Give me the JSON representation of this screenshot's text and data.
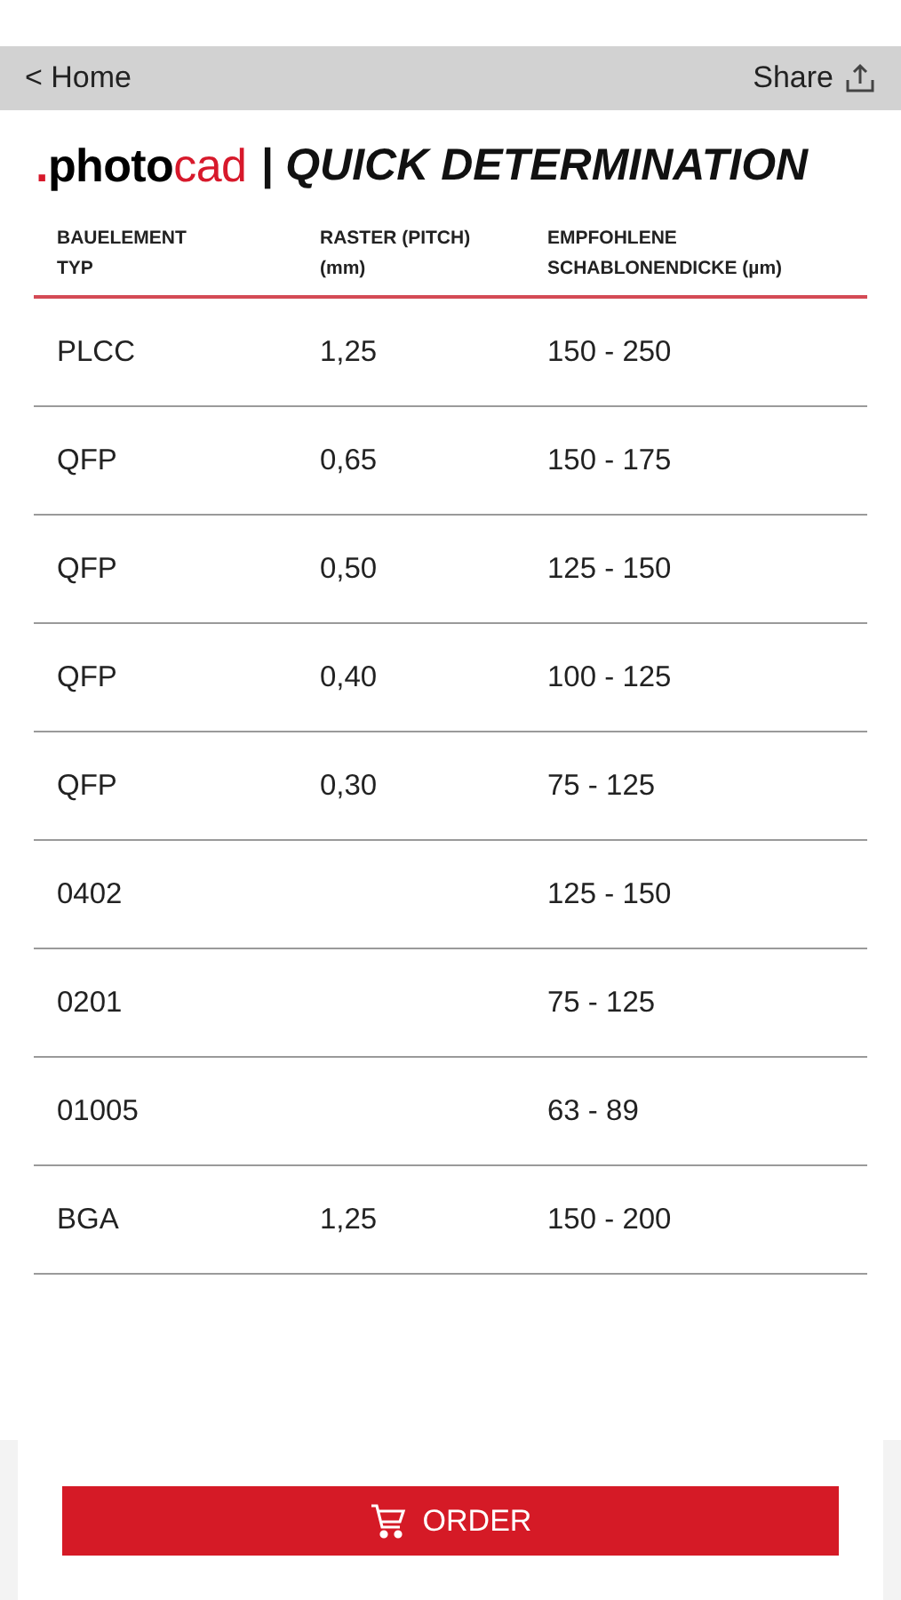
{
  "nav": {
    "back": "< Home",
    "share": "Share"
  },
  "heading": {
    "logo_dot": ".",
    "logo_main": "photo",
    "logo_accent": "cad",
    "title": "| QUICK DETERMINATION"
  },
  "table": {
    "columns": [
      "BAUELEMENT\nTYP",
      "RASTER (PITCH)\n(mm)",
      "EMPFOHLENE\nSCHABLONENDICKE (µm)"
    ],
    "rows": [
      [
        "PLCC",
        "1,25",
        "150 - 250"
      ],
      [
        "QFP",
        "0,65",
        "150 - 175"
      ],
      [
        "QFP",
        "0,50",
        "125 - 150"
      ],
      [
        "QFP",
        "0,40",
        "100 - 125"
      ],
      [
        "QFP",
        "0,30",
        "75 - 125"
      ],
      [
        "0402",
        "",
        "125 - 150"
      ],
      [
        "0201",
        "",
        "75 - 125"
      ],
      [
        "01005",
        "",
        "63 - 89"
      ],
      [
        "BGA",
        "1,25",
        "150 - 200"
      ]
    ]
  },
  "order_button": "ORDER"
}
